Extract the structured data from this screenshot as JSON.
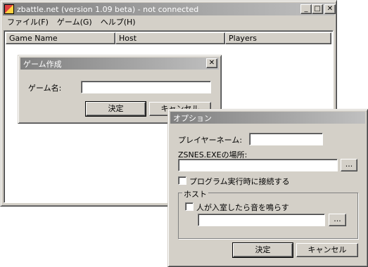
{
  "main_window": {
    "title": "zbattle.net (version 1.09 beta) - not connected",
    "menu": [
      "ファイル(F)",
      "ゲーム(G)",
      "ヘルプ(H)"
    ],
    "columns": [
      "Game Name",
      "Host",
      "Players"
    ],
    "controls": {
      "minimize": "_",
      "maximize": "□",
      "close": "✕"
    }
  },
  "create_game_dialog": {
    "title": "ゲーム作成",
    "close": "✕",
    "game_name_label": "ゲーム名:",
    "game_name_value": "",
    "ok_label": "決定",
    "cancel_label": "キャンセル"
  },
  "options_dialog": {
    "title": "オプション",
    "player_name_label": "プレイヤーネーム:",
    "player_name_value": "",
    "zsnes_label": "ZSNES.EXEの場所:",
    "zsnes_path_value": "",
    "browse_label": "...",
    "connect_on_start_label": "プログラム実行時に接続する",
    "connect_on_start_checked": false,
    "host_group_label": "ホスト",
    "sound_on_join_label": "人が入室したら音を鳴らす",
    "sound_on_join_checked": false,
    "sound_path_value": "",
    "ok_label": "決定",
    "cancel_label": "キャンセル"
  }
}
